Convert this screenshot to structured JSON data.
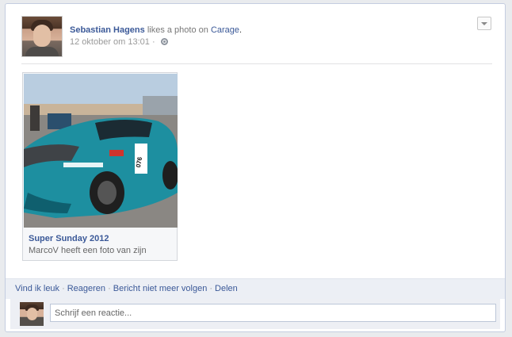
{
  "story": {
    "actor_name": "Sebastian Hagens",
    "verb_text": " likes a photo on ",
    "page_name": "Carage",
    "period": ".",
    "timestamp": "12 oktober om 13:01",
    "meta_separator": " ·",
    "privacy_icon": "globe-icon",
    "menu_icon": "chevron-down-icon"
  },
  "attachment": {
    "title": "Super Sunday 2012",
    "subtitle": "MarcoV heeft een foto van zijn",
    "photo_colors": {
      "sky": "#b9cde0",
      "car_body": "#1d8fa0",
      "car_dark": "#0f5f6e",
      "road": "#8a8783"
    },
    "race_number": "076"
  },
  "actions": {
    "like": "Vind ik leuk",
    "comment": "Reageren",
    "unfollow": "Bericht niet meer volgen",
    "share": "Delen",
    "separator": "·"
  },
  "comment_box": {
    "placeholder": "Schrijf een reactie..."
  },
  "colors": {
    "link": "#3b5998",
    "footer_bg": "#eceff5",
    "border": "#c4cde0"
  }
}
